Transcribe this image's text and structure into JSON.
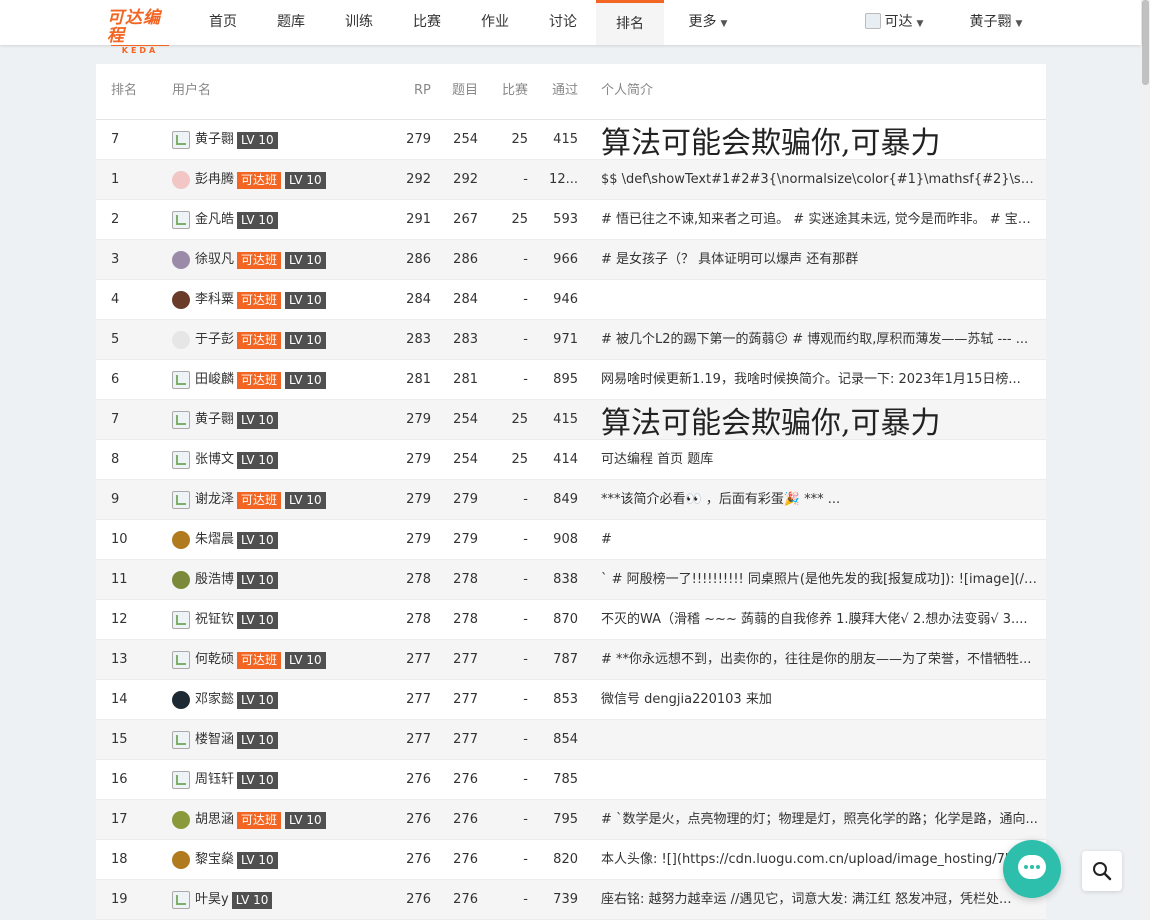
{
  "nav": {
    "logo_cn": "可达编程",
    "logo_en": "KEDA",
    "items": [
      "首页",
      "题库",
      "训练",
      "比赛",
      "作业",
      "讨论",
      "排名",
      "更多"
    ],
    "active": "排名",
    "lang": "可达",
    "user": "黄子翾"
  },
  "table": {
    "headers": {
      "rank": "排名",
      "user": "用户名",
      "rp": "RP",
      "solved": "题目",
      "contest": "比赛",
      "passed": "通过",
      "bio": "个人简介"
    },
    "rows": [
      {
        "rank": "7",
        "name": "黄子翾",
        "class": "",
        "level": "LV 10",
        "rp": "279",
        "solved": "254",
        "contest": "25",
        "passed": "415",
        "bio": "算法可能会欺骗你,可暴力",
        "avatar": "broken"
      },
      {
        "rank": "1",
        "name": "彭冉腾",
        "class": "可达班",
        "level": "LV 10",
        "rp": "292",
        "solved": "292",
        "contest": "-",
        "passed": "12...",
        "bio": "$$ \\def\\showText#1#2#3{\\normalsize\\color{#1}\\mathsf{#2}\\scrip...",
        "avatar": "#f3c6c6"
      },
      {
        "rank": "2",
        "name": "金凡皓",
        "class": "",
        "level": "LV 10",
        "rp": "291",
        "solved": "267",
        "contest": "25",
        "passed": "593",
        "bio": "# 悟已往之不谏,知来者之可追。 # 实迷途其未远, 觉今是而昨非。 # 宝剑...",
        "avatar": "broken"
      },
      {
        "rank": "3",
        "name": "徐驭凡",
        "class": "可达班",
        "level": "LV 10",
        "rp": "286",
        "solved": "286",
        "contest": "-",
        "passed": "966",
        "bio": "# 是女孩子（？  具体证明可以爆声 还有那群",
        "avatar": "#9c8ba8"
      },
      {
        "rank": "4",
        "name": "李科粟",
        "class": "可达班",
        "level": "LV 10",
        "rp": "284",
        "solved": "284",
        "contest": "-",
        "passed": "946",
        "bio": "",
        "avatar": "#6b3b2a"
      },
      {
        "rank": "5",
        "name": "于子彭",
        "class": "可达班",
        "level": "LV 10",
        "rp": "283",
        "solved": "283",
        "contest": "-",
        "passed": "971",
        "bio": "# 被几个L2的踢下第一的蒟蒻😕 # 博观而约取,厚积而薄发——苏轼 --- ...",
        "avatar": "#e6e6e6"
      },
      {
        "rank": "6",
        "name": "田峻麟",
        "class": "可达班",
        "level": "LV 10",
        "rp": "281",
        "solved": "281",
        "contest": "-",
        "passed": "895",
        "bio": "网易啥时候更新1.19，我啥时候换简介。记录一下: 2023年1月15日榜...",
        "avatar": "broken"
      },
      {
        "rank": "7",
        "name": "黄子翾",
        "class": "",
        "level": "LV 10",
        "rp": "279",
        "solved": "254",
        "contest": "25",
        "passed": "415",
        "bio": "算法可能会欺骗你,可暴力",
        "avatar": "broken"
      },
      {
        "rank": "8",
        "name": "张博文",
        "class": "",
        "level": "LV 10",
        "rp": "279",
        "solved": "254",
        "contest": "25",
        "passed": "414",
        "bio": "可达编程   首页   题库",
        "avatar": "broken"
      },
      {
        "rank": "9",
        "name": "谢龙泽",
        "class": "可达班",
        "level": "LV 10",
        "rp": "279",
        "solved": "279",
        "contest": "-",
        "passed": "849",
        "bio": "***该简介必看👀 ，后面有彩蛋🎉 *** ...",
        "avatar": "broken"
      },
      {
        "rank": "10",
        "name": "朱熠晨",
        "class": "",
        "level": "LV 10",
        "rp": "279",
        "solved": "279",
        "contest": "-",
        "passed": "908",
        "bio": "#",
        "avatar": "#b07a1e"
      },
      {
        "rank": "11",
        "name": "殷浩博",
        "class": "",
        "level": "LV 10",
        "rp": "278",
        "solved": "278",
        "contest": "-",
        "passed": "838",
        "bio": "` # 阿殷榜一了!!!!!!!!!! 同桌照片(是他先发的我[报复成功]): ![image](/file...",
        "avatar": "#7a8a3a"
      },
      {
        "rank": "12",
        "name": "祝钲钦",
        "class": "",
        "level": "LV 10",
        "rp": "278",
        "solved": "278",
        "contest": "-",
        "passed": "870",
        "bio": "不灭的WA（滑稽 ~~~ 蒟蒻的自我修养 1.膜拜大佬√ 2.想办法变弱√ 3....",
        "avatar": "broken"
      },
      {
        "rank": "13",
        "name": "何乾硕",
        "class": "可达班",
        "level": "LV 10",
        "rp": "277",
        "solved": "277",
        "contest": "-",
        "passed": "787",
        "bio": "# **你永远想不到，出卖你的，往往是你的朋友——为了荣誉，不惜牺牲...",
        "avatar": "broken"
      },
      {
        "rank": "14",
        "name": "邓家懿",
        "class": "",
        "level": "LV 10",
        "rp": "277",
        "solved": "277",
        "contest": "-",
        "passed": "853",
        "bio": "微信号 dengjia220103 来加",
        "avatar": "#1e2a33"
      },
      {
        "rank": "15",
        "name": "楼智涵",
        "class": "",
        "level": "LV 10",
        "rp": "277",
        "solved": "277",
        "contest": "-",
        "passed": "854",
        "bio": "",
        "avatar": "broken"
      },
      {
        "rank": "16",
        "name": "周钰轩",
        "class": "",
        "level": "LV 10",
        "rp": "276",
        "solved": "276",
        "contest": "-",
        "passed": "785",
        "bio": "",
        "avatar": "broken"
      },
      {
        "rank": "17",
        "name": "胡思涵",
        "class": "可达班",
        "level": "LV 10",
        "rp": "276",
        "solved": "276",
        "contest": "-",
        "passed": "795",
        "bio": "# `数学是火，点亮物理的灯；物理是灯，照亮化学的路；化学是路，通向...",
        "avatar": "#8a9a3a"
      },
      {
        "rank": "18",
        "name": "黎宝燊",
        "class": "",
        "level": "LV 10",
        "rp": "276",
        "solved": "276",
        "contest": "-",
        "passed": "820",
        "bio": "本人头像: ![](https://cdn.luogu.com.cn/upload/image_hosting/7k9...",
        "avatar": "#b07a1e"
      },
      {
        "rank": "19",
        "name": "叶昊y",
        "class": "",
        "level": "LV 10",
        "rp": "276",
        "solved": "276",
        "contest": "-",
        "passed": "739",
        "bio": "座右铭: 越努力越幸运 //遇见它，词意大发: 满江红 怒发冲冠，凭栏处...",
        "avatar": "broken"
      }
    ]
  }
}
